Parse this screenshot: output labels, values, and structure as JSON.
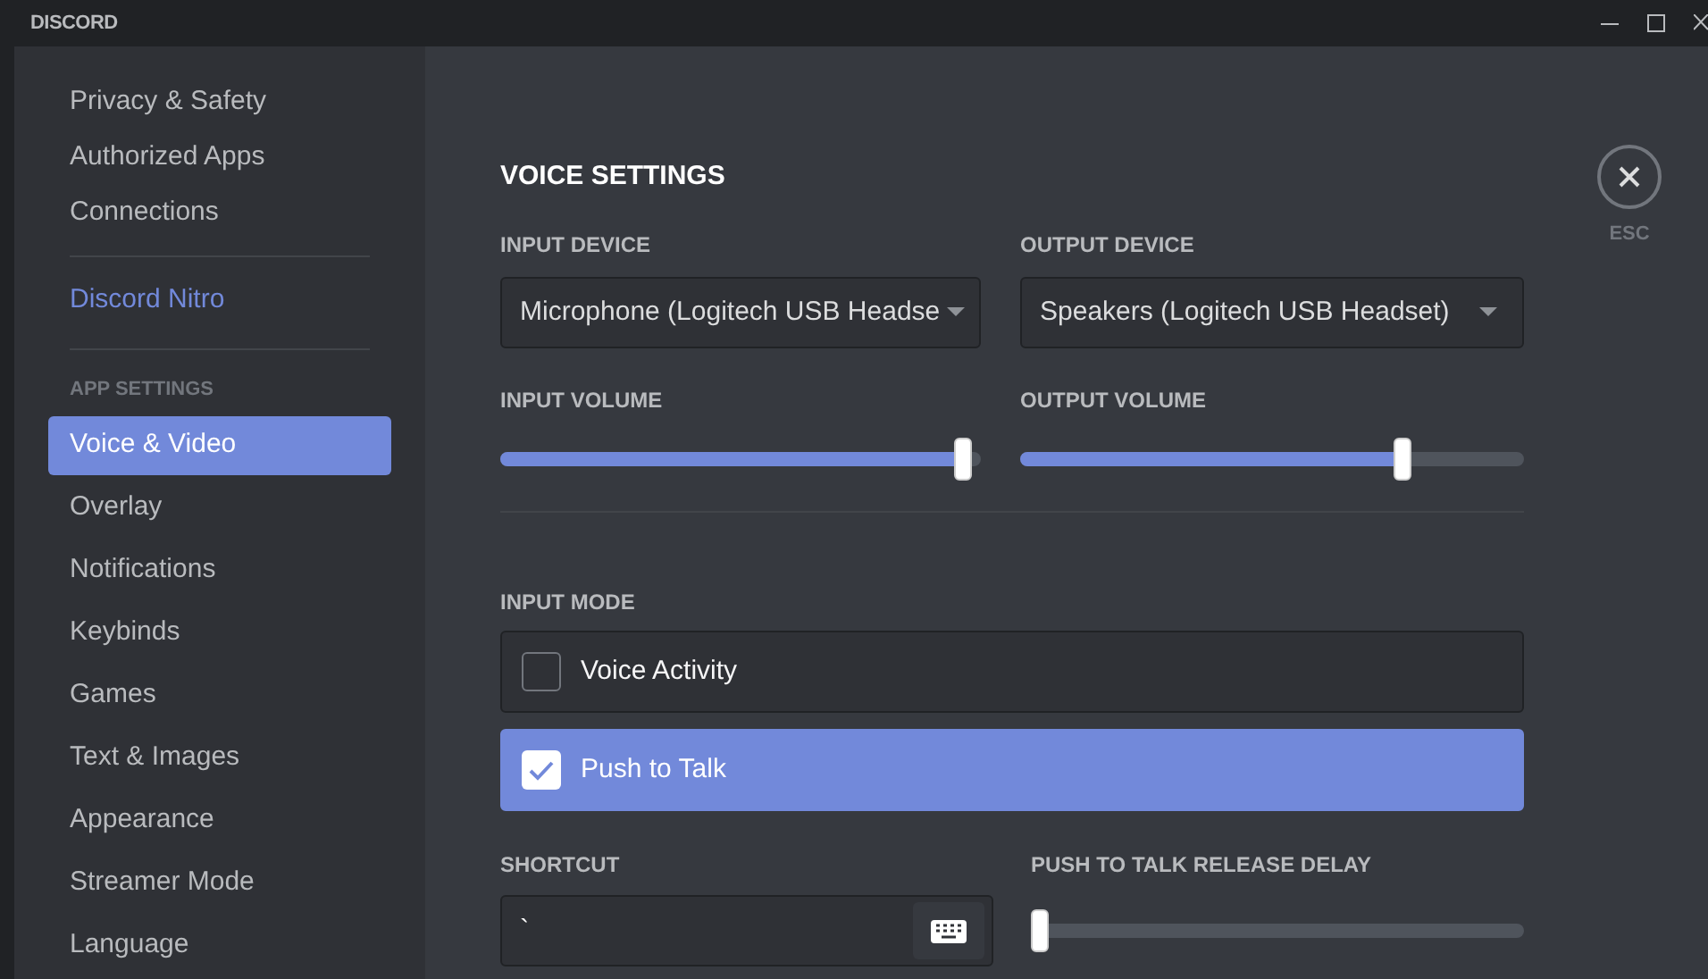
{
  "title_bar": {
    "logo": "DISCORD"
  },
  "sidebar": {
    "user_settings": [
      {
        "label": "Privacy & Safety",
        "selected": false
      },
      {
        "label": "Authorized Apps",
        "selected": false
      },
      {
        "label": "Connections",
        "selected": false
      }
    ],
    "nitro": {
      "label": "Discord Nitro",
      "selected": false
    },
    "app_settings": {
      "header": "APP SETTINGS",
      "items": [
        {
          "label": "Voice & Video",
          "selected": true
        },
        {
          "label": "Overlay",
          "selected": false
        },
        {
          "label": "Notifications",
          "selected": false
        },
        {
          "label": "Keybinds",
          "selected": false
        },
        {
          "label": "Games",
          "selected": false
        },
        {
          "label": "Text & Images",
          "selected": false
        },
        {
          "label": "Appearance",
          "selected": false
        },
        {
          "label": "Streamer Mode",
          "selected": false
        },
        {
          "label": "Language",
          "selected": false
        }
      ]
    }
  },
  "voice_settings": {
    "title": "VOICE SETTINGS",
    "input_device": {
      "label": "INPUT DEVICE",
      "value": "Microphone (Logitech USB Headse"
    },
    "output_device": {
      "label": "OUTPUT DEVICE",
      "value": "Speakers (Logitech USB Headset)"
    },
    "input_volume": {
      "label": "INPUT VOLUME",
      "level": 0.98
    },
    "output_volume": {
      "label": "OUTPUT VOLUME",
      "level": 0.77
    },
    "input_mode": {
      "label": "INPUT MODE",
      "options": [
        {
          "label": "Voice Activity",
          "selected": false
        },
        {
          "label": "Push to Talk",
          "selected": true
        }
      ]
    },
    "shortcut": {
      "label": "SHORTCUT",
      "value": "`"
    },
    "release_delay": {
      "label": "PUSH TO TALK RELEASE DELAY",
      "level": 0
    }
  },
  "close": {
    "label": "ESC"
  }
}
